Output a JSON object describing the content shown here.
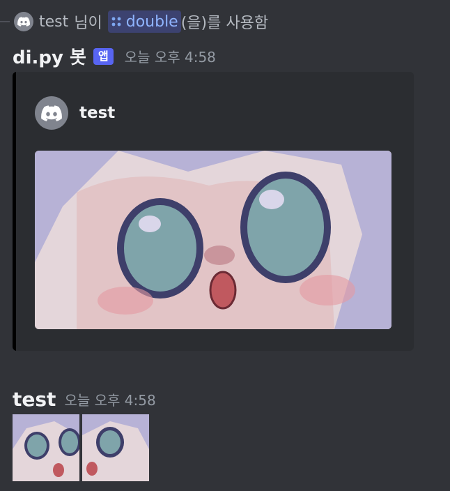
{
  "reply": {
    "user": "test",
    "suffix_before": "님이",
    "command": "double",
    "suffix_after": "(을)를 사용함"
  },
  "message1": {
    "author": "di.py 봇",
    "badge": "앱",
    "timestamp": "오늘 오후 4:58",
    "embed": {
      "author_name": "test",
      "image_desc": "anime-face-image",
      "left_bar_color": "#000000"
    }
  },
  "message2": {
    "author": "test",
    "timestamp": "오늘 오후 4:58",
    "attachments": [
      "anime-face-image",
      "anime-face-image"
    ]
  },
  "colors": {
    "background": "#313338",
    "embed_bg": "#2b2d31",
    "badge": "#5865f2",
    "command_chip": "#3c4270"
  }
}
